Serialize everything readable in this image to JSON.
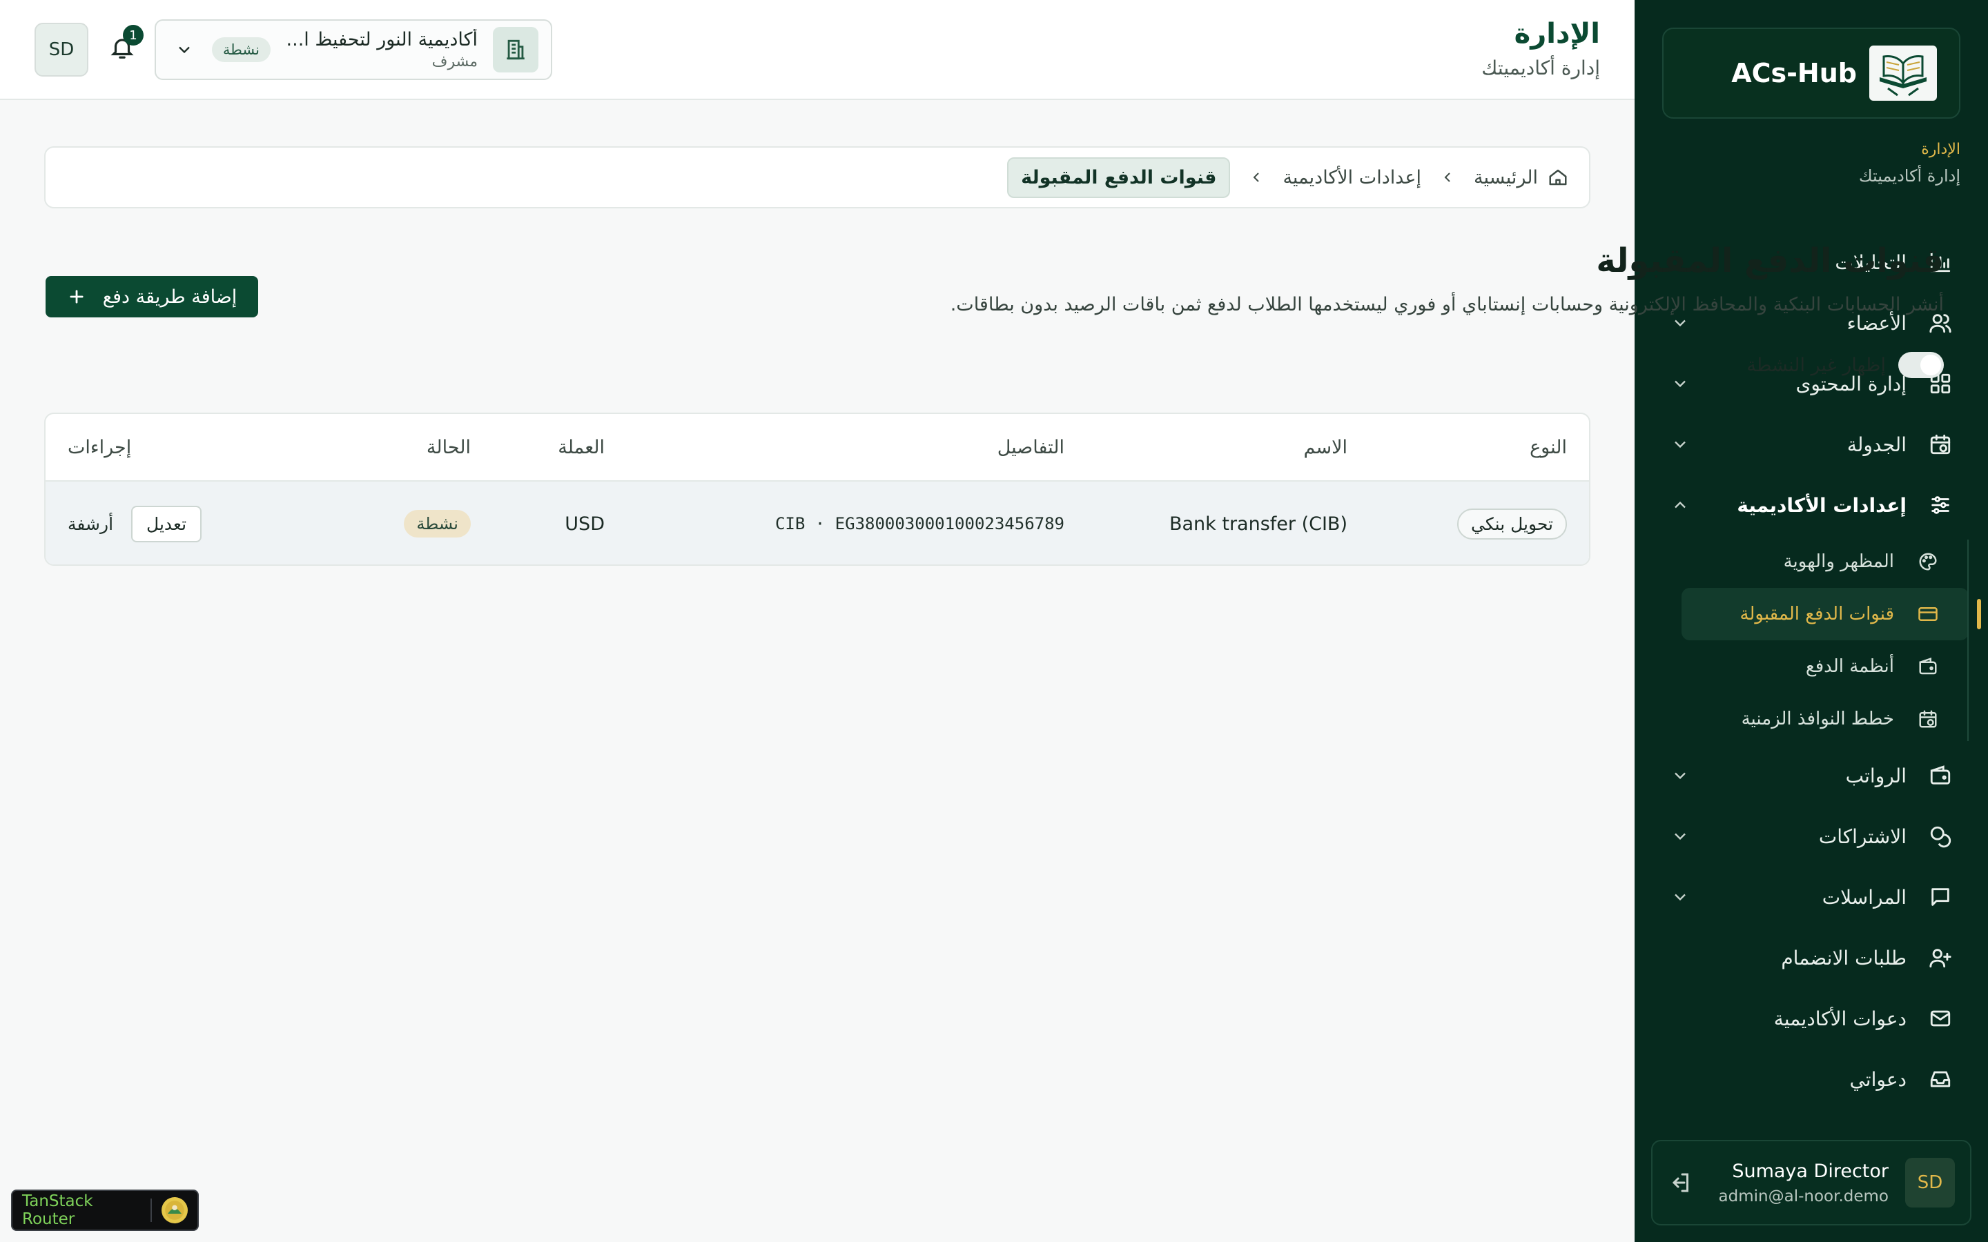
{
  "brand": {
    "name": "ACs-Hub"
  },
  "sidebar": {
    "context_title": "الإدارة",
    "context_sub": "إدارة أكاديميتك",
    "items": [
      {
        "label": "التحليلات",
        "icon": "bar-chart-icon",
        "expandable": false
      },
      {
        "label": "الأعضاء",
        "icon": "users-icon",
        "expandable": true
      },
      {
        "label": "إدارة المحتوى",
        "icon": "grid-icon",
        "expandable": true
      },
      {
        "label": "الجدولة",
        "icon": "calendar-clock-icon",
        "expandable": true
      },
      {
        "label": "إعدادات الأكاديمية",
        "icon": "sliders-icon",
        "expandable": true,
        "open": true
      },
      {
        "label": "الرواتب",
        "icon": "wallet-icon",
        "expandable": true
      },
      {
        "label": "الاشتراكات",
        "icon": "coins-icon",
        "expandable": true
      },
      {
        "label": "المراسلات",
        "icon": "message-icon",
        "expandable": true
      },
      {
        "label": "طلبات الانضمام",
        "icon": "user-plus-icon",
        "expandable": false
      },
      {
        "label": "دعوات الأكاديمية",
        "icon": "mail-icon",
        "expandable": false
      },
      {
        "label": "دعواتي",
        "icon": "inbox-icon",
        "expandable": false
      }
    ],
    "sub_items": [
      {
        "label": "المظهر والهوية",
        "icon": "palette-icon"
      },
      {
        "label": "قنوات الدفع المقبولة",
        "icon": "credit-card-icon",
        "active": true
      },
      {
        "label": "أنظمة الدفع",
        "icon": "wallet-icon"
      },
      {
        "label": "خطط النوافذ الزمنية",
        "icon": "calendar-clock-icon"
      }
    ],
    "user": {
      "initials": "SD",
      "name": "Sumaya Director",
      "email": "admin@al-noor.demo"
    }
  },
  "header": {
    "title": "الإدارة",
    "subtitle": "إدارة أكاديميتك",
    "avatar_initials": "SD",
    "notification_count": "1",
    "academy": {
      "name": "أكاديمية النور لتحفيظ ا...",
      "role": "مشرف",
      "status": "نشطة"
    }
  },
  "breadcrumb": {
    "home": "الرئيسية",
    "section": "إعدادات الأكاديمية",
    "current": "قنوات الدفع المقبولة"
  },
  "page": {
    "title": "قنوات الدفع المقبولة",
    "description": "أنشر الحسابات البنكية والمحافظ الإلكترونية وحسابات إنستاباي أو فوري ليستخدمها الطلاب لدفع ثمن باقات الرصيد بدون بطاقات.",
    "add_button": "إضافة طريقة دفع",
    "toggle_label": "إظهار غير النشطة",
    "show_inactive": false
  },
  "table": {
    "headers": {
      "type": "النوع",
      "name": "الاسم",
      "details": "التفاصيل",
      "currency": "العملة",
      "status": "الحالة",
      "actions": "إجراءات"
    },
    "rows": [
      {
        "type": "تحويل بنكي",
        "name": "Bank transfer (CIB)",
        "details": "CIB · EG380003000100023456789",
        "currency": "USD",
        "status": "نشطة",
        "edit": "تعديل",
        "archive": "أرشفة"
      }
    ]
  },
  "devtools": {
    "label": "TanStack Router"
  },
  "colors": {
    "sidebar_bg": "#062a1e",
    "accent_green": "#0b4a32",
    "accent_gold": "#e1b84a"
  }
}
